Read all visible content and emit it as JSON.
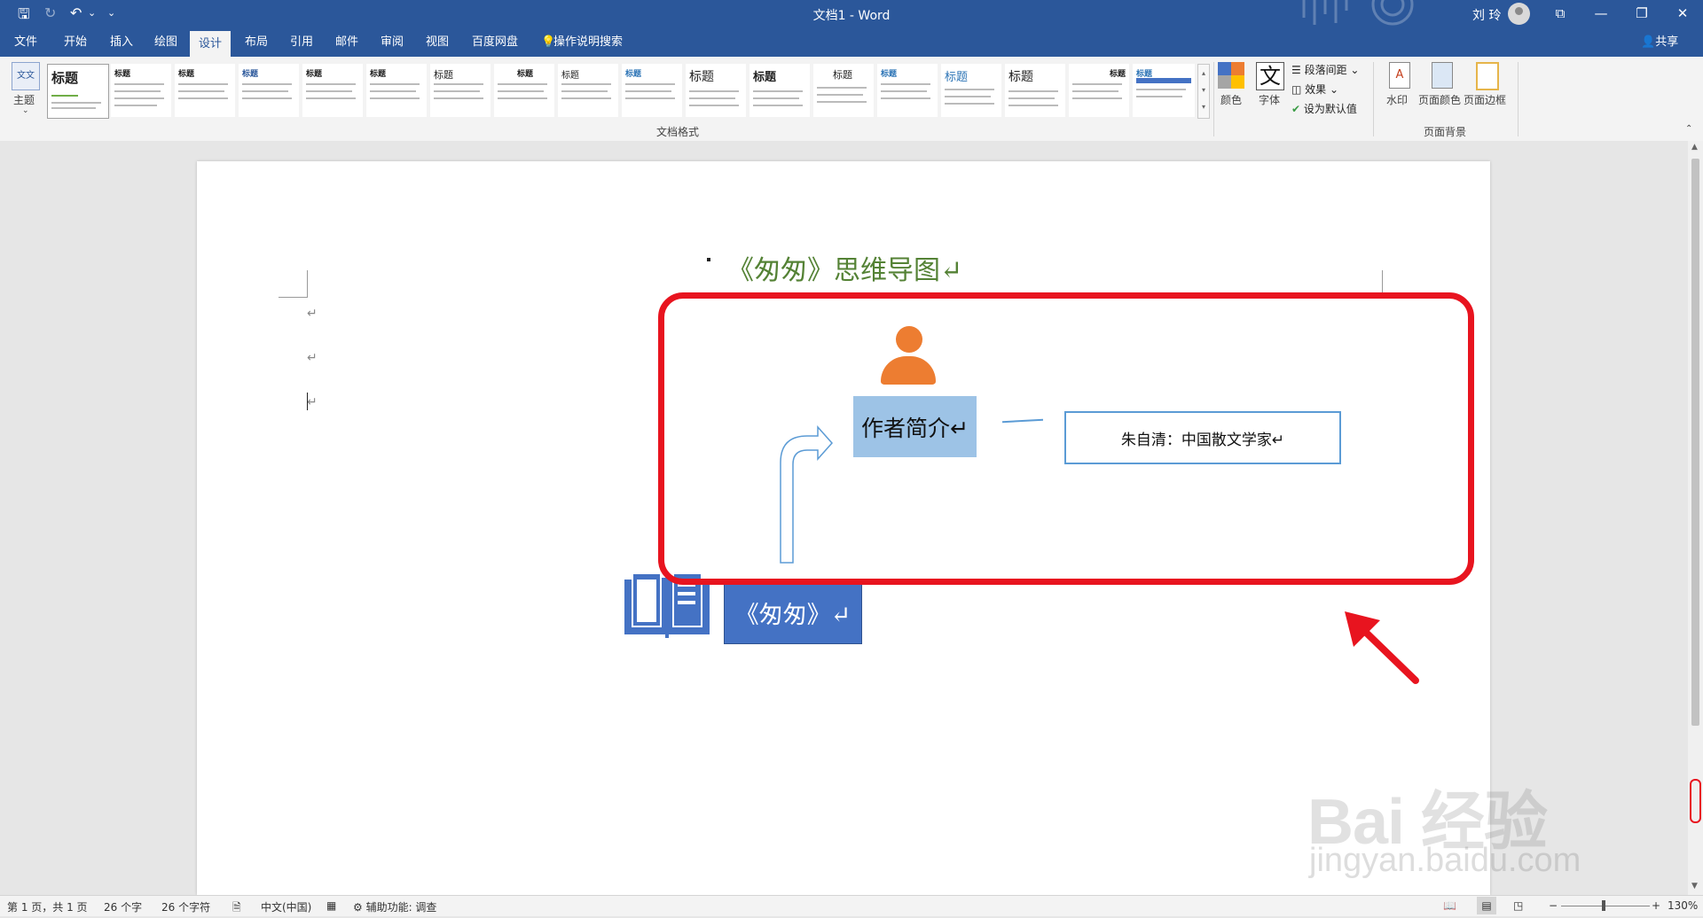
{
  "titlebar": {
    "doc_title": "文档1 - Word",
    "user_name": "刘 玲",
    "qa_save": "🖫",
    "qa_redo": "↻",
    "qa_undo": "↶",
    "qa_undo_drop": "⌄",
    "qa_customize": "⌄",
    "min": "—",
    "restore": "❐",
    "close": "✕",
    "ribbon_opts": "⧉"
  },
  "tabs": [
    "文件",
    "开始",
    "插入",
    "绘图",
    "设计",
    "布局",
    "引用",
    "邮件",
    "审阅",
    "视图",
    "百度网盘"
  ],
  "tell_me": "操作说明搜索",
  "share": "共享",
  "ribbon": {
    "theme_label": "主题",
    "theme_icon_text": "文文",
    "gallery_item_titles": [
      "标题",
      "标题",
      "标题",
      "标题",
      "标题",
      "标题",
      "标题",
      "标题",
      "标题",
      "标题",
      "标题",
      "标题",
      "标题",
      "标题",
      "标题",
      "标题",
      "标题",
      "标题"
    ],
    "doc_format_group": "文档格式",
    "colors_label": "颜色",
    "fonts_label": "字体",
    "fonts_glyph": "文",
    "para_spacing": "段落间距",
    "effects": "效果",
    "set_default": "设为默认值",
    "watermark": "水印",
    "page_color": "页面颜色",
    "page_border": "页面边框",
    "page_bg_group": "页面背景",
    "colors": {
      "c1": "#4472c4",
      "c2": "#ed7d31",
      "c3": "#a5a5a5",
      "c4": "#ffc000"
    }
  },
  "document": {
    "heading": "《匆匆》思维导图↵",
    "author_box": "作者简介↵",
    "info_box": "朱自清：中国散文学家↵",
    "title_box": "《匆匆》↵",
    "para_mark": "↵",
    "colors": {
      "heading": "#548235",
      "person": "#ed7d31",
      "author_fill": "#9dc3e6",
      "title_fill": "#4472c4",
      "highlight": "#e8141f",
      "arrow": "#5b9bd5"
    }
  },
  "status": {
    "page": "第 1 页，共 1 页",
    "words": "26 个字",
    "chars": "26 个字符",
    "lang": "中文(中国)",
    "accessibility": "辅助功能: 调查",
    "zoom": "130%",
    "minus": "−",
    "plus": "+"
  },
  "watermark": {
    "main": "Bai 经验",
    "sub": "jingyan.baidu.com"
  }
}
